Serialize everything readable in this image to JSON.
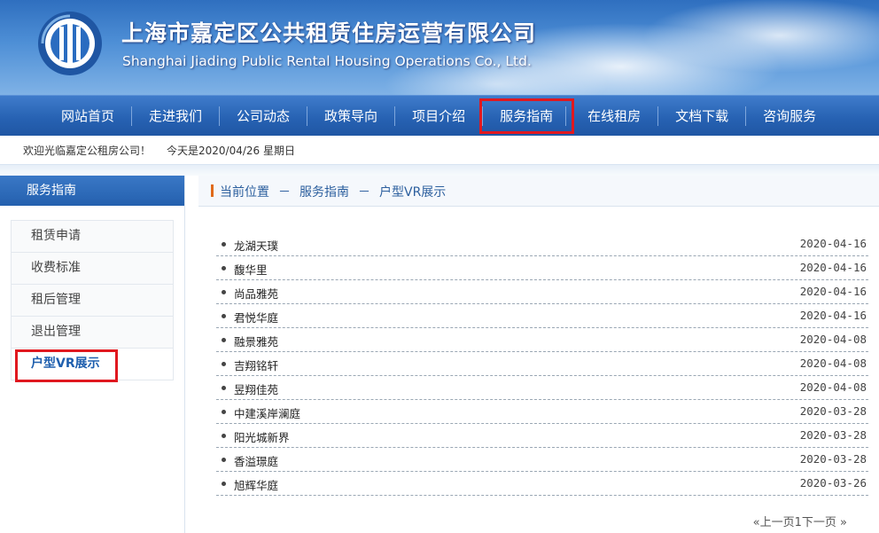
{
  "header": {
    "title_cn": "上海市嘉定区公共租赁住房运营有限公司",
    "title_en": "Shanghai Jiading Public Rental Housing Operations Co., Ltd."
  },
  "nav": {
    "items": [
      "网站首页",
      "走进我们",
      "公司动态",
      "政策导向",
      "项目介绍",
      "服务指南",
      "在线租房",
      "文档下载",
      "咨询服务"
    ],
    "active": "服务指南"
  },
  "welcome": {
    "greeting": "欢迎光临嘉定公租房公司！",
    "today": "今天是2020/04/26 星期日"
  },
  "sidebar": {
    "heading": "服务指南",
    "items": [
      "租赁申请",
      "收费标准",
      "租后管理",
      "退出管理",
      "户型VR展示"
    ],
    "active": "户型VR展示"
  },
  "breadcrumb": {
    "label": "当前位置",
    "sep": "－",
    "level1": "服务指南",
    "level2": "户型VR展示"
  },
  "list": [
    {
      "name": "龙湖天璞",
      "date": "2020-04-16"
    },
    {
      "name": "馥华里",
      "date": "2020-04-16"
    },
    {
      "name": "尚品雅苑",
      "date": "2020-04-16"
    },
    {
      "name": "君悦华庭",
      "date": "2020-04-16"
    },
    {
      "name": "融景雅苑",
      "date": "2020-04-08"
    },
    {
      "name": "吉翔铭轩",
      "date": "2020-04-08"
    },
    {
      "name": "昱翔佳苑",
      "date": "2020-04-08"
    },
    {
      "name": "中建溪岸澜庭",
      "date": "2020-03-28"
    },
    {
      "name": "阳光城新界",
      "date": "2020-03-28"
    },
    {
      "name": "香溢璟庭",
      "date": "2020-03-28"
    },
    {
      "name": "旭辉华庭",
      "date": "2020-03-26"
    }
  ],
  "pager": {
    "prev": "«上一页",
    "page": "1",
    "next": "下一页 »"
  },
  "colors": {
    "nav_blue": "#2762b3",
    "highlight_red": "#e0181f",
    "breadcrumb_accent": "#e06a1a"
  }
}
